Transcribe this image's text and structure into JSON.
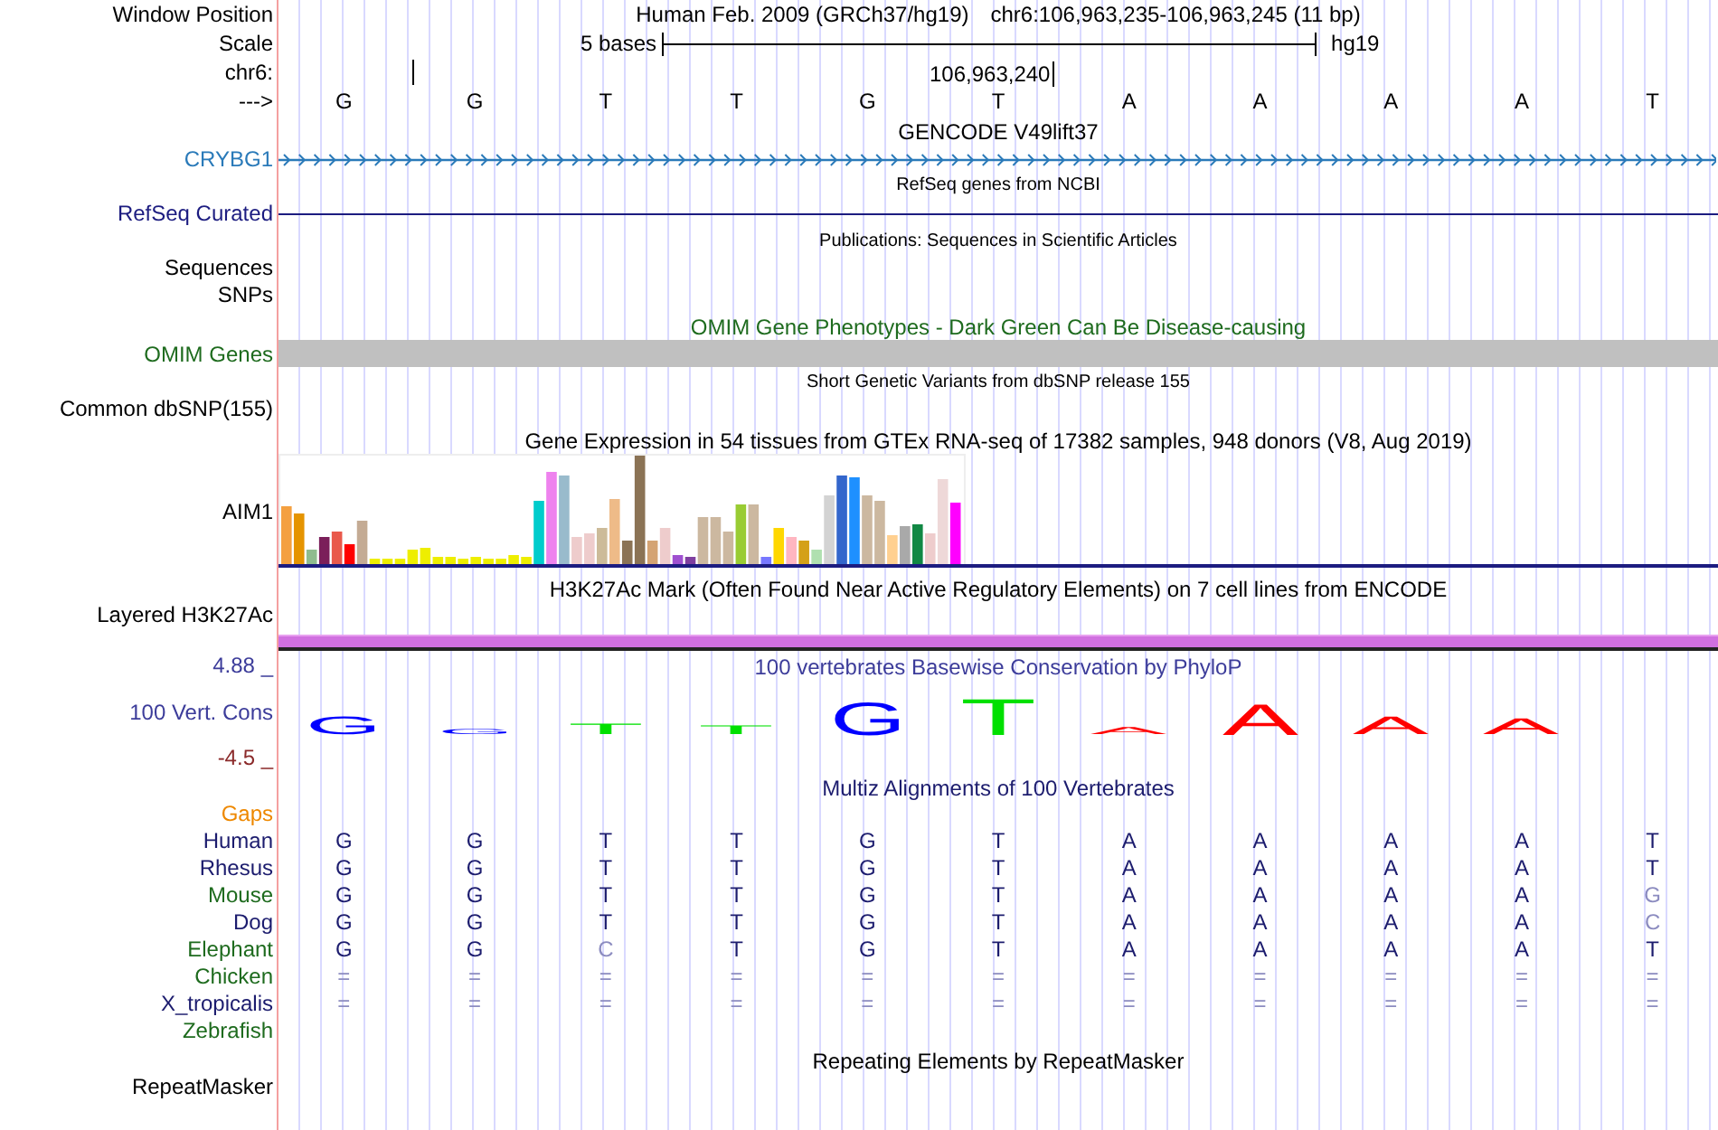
{
  "ruler": {
    "window_label": "Window Position",
    "assembly": "Human Feb. 2009 (GRCh37/hg19)",
    "position": "chr6:106,963,235-106,963,245 (11 bp)",
    "scale_label": "Scale",
    "scale_text": "5 bases",
    "scale_db": "hg19",
    "chrom_label": "chr6:",
    "coordinate": "106,963,240",
    "strand_label": "--->",
    "bases": [
      "G",
      "G",
      "T",
      "T",
      "G",
      "T",
      "A",
      "A",
      "A",
      "A",
      "T"
    ]
  },
  "tracks": [
    {
      "kind": "gene",
      "title": "GENCODE V49lift37",
      "labels": [
        "CRYBG1"
      ],
      "color": "#2a7ab9"
    },
    {
      "kind": "line",
      "title": "RefSeq genes from NCBI",
      "labels": [
        "RefSeq Curated"
      ],
      "color": "#1c1c80"
    },
    {
      "kind": "empty",
      "title": "Publications: Sequences in Scientific Articles",
      "labels": [
        "Sequences",
        "SNPs"
      ],
      "color": "#000000"
    },
    {
      "kind": "bar",
      "title": "OMIM Gene Phenotypes - Dark Green Can Be Disease-causing",
      "labels": [
        "OMIM Genes"
      ],
      "color": "#1e6b1e"
    },
    {
      "kind": "empty",
      "title": "Short Genetic Variants from dbSNP release 155",
      "labels": [
        "Common dbSNP(155)"
      ],
      "color": "#000000"
    },
    {
      "kind": "expression",
      "title": "Gene Expression in 54 tissues from GTEx RNA-seq of 17382 samples, 948 donors (V8, Aug 2019)",
      "labels": [
        "AIM1"
      ],
      "color": "#000000"
    },
    {
      "kind": "layered",
      "title": "H3K27Ac Mark (Often Found Near Active Regulatory Elements) on 7 cell lines from ENCODE",
      "labels": [
        "Layered H3K27Ac"
      ],
      "color": "#000000"
    },
    {
      "kind": "conservation",
      "title": "100 vertebrates Basewise Conservation by PhyloP",
      "labels": [
        "100 Vert. Cons"
      ],
      "color": "#3c3c9a",
      "max_label": "4.88 _",
      "min_label": "-4.5 _",
      "letters": [
        {
          "base": "G",
          "color": "#0000ff"
        },
        {
          "base": "G",
          "color": "#0000ff"
        },
        {
          "base": "T",
          "color": "#00e000"
        },
        {
          "base": "T",
          "color": "#00e000"
        },
        {
          "base": "G",
          "color": "#0000ff"
        },
        {
          "base": "T",
          "color": "#00e000"
        },
        {
          "base": "A",
          "color": "#ff0000"
        },
        {
          "base": "A",
          "color": "#ff0000"
        },
        {
          "base": "A",
          "color": "#ff0000"
        },
        {
          "base": "A",
          "color": "#ff0000"
        }
      ]
    },
    {
      "kind": "alignment",
      "title": "Multiz Alignments of 100 Vertebrates",
      "labels": [
        "Gaps"
      ],
      "color": "#ee8800",
      "species": [
        {
          "name": "Human",
          "color": "#1c1c6e",
          "bases": [
            {
              "text": "G",
              "faint": false
            },
            {
              "text": "G",
              "faint": false
            },
            {
              "text": "T",
              "faint": false
            },
            {
              "text": "T",
              "faint": false
            },
            {
              "text": "G",
              "faint": false
            },
            {
              "text": "T",
              "faint": false
            },
            {
              "text": "A",
              "faint": false
            },
            {
              "text": "A",
              "faint": false
            },
            {
              "text": "A",
              "faint": false
            },
            {
              "text": "A",
              "faint": false
            },
            {
              "text": "T",
              "faint": false
            }
          ]
        },
        {
          "name": "Rhesus",
          "color": "#1c1c6e",
          "bases": [
            {
              "text": "G",
              "faint": false
            },
            {
              "text": "G",
              "faint": false
            },
            {
              "text": "T",
              "faint": false
            },
            {
              "text": "T",
              "faint": false
            },
            {
              "text": "G",
              "faint": false
            },
            {
              "text": "T",
              "faint": false
            },
            {
              "text": "A",
              "faint": false
            },
            {
              "text": "A",
              "faint": false
            },
            {
              "text": "A",
              "faint": false
            },
            {
              "text": "A",
              "faint": false
            },
            {
              "text": "T",
              "faint": false
            }
          ]
        },
        {
          "name": "Mouse",
          "color": "#1e6b1e",
          "bases": [
            {
              "text": "G",
              "faint": false
            },
            {
              "text": "G",
              "faint": false
            },
            {
              "text": "T",
              "faint": false
            },
            {
              "text": "T",
              "faint": false
            },
            {
              "text": "G",
              "faint": false
            },
            {
              "text": "T",
              "faint": false
            },
            {
              "text": "A",
              "faint": false
            },
            {
              "text": "A",
              "faint": false
            },
            {
              "text": "A",
              "faint": false
            },
            {
              "text": "A",
              "faint": false
            },
            {
              "text": "G",
              "faint": true
            }
          ]
        },
        {
          "name": "Dog",
          "color": "#1c1c6e",
          "bases": [
            {
              "text": "G",
              "faint": false
            },
            {
              "text": "G",
              "faint": false
            },
            {
              "text": "T",
              "faint": false
            },
            {
              "text": "T",
              "faint": false
            },
            {
              "text": "G",
              "faint": false
            },
            {
              "text": "T",
              "faint": false
            },
            {
              "text": "A",
              "faint": false
            },
            {
              "text": "A",
              "faint": false
            },
            {
              "text": "A",
              "faint": false
            },
            {
              "text": "A",
              "faint": false
            },
            {
              "text": "C",
              "faint": true
            }
          ]
        },
        {
          "name": "Elephant",
          "color": "#1e6b1e",
          "bases": [
            {
              "text": "G",
              "faint": false
            },
            {
              "text": "G",
              "faint": false
            },
            {
              "text": "C",
              "faint": true
            },
            {
              "text": "T",
              "faint": false
            },
            {
              "text": "G",
              "faint": false
            },
            {
              "text": "T",
              "faint": false
            },
            {
              "text": "A",
              "faint": false
            },
            {
              "text": "A",
              "faint": false
            },
            {
              "text": "A",
              "faint": false
            },
            {
              "text": "A",
              "faint": false
            },
            {
              "text": "T",
              "faint": false
            }
          ]
        },
        {
          "name": "Chicken",
          "color": "#1e6b1e",
          "bases": [
            {
              "text": "=",
              "faint": true
            },
            {
              "text": "=",
              "faint": true
            },
            {
              "text": "=",
              "faint": true
            },
            {
              "text": "=",
              "faint": true
            },
            {
              "text": "=",
              "faint": true
            },
            {
              "text": "=",
              "faint": true
            },
            {
              "text": "=",
              "faint": true
            },
            {
              "text": "=",
              "faint": true
            },
            {
              "text": "=",
              "faint": true
            },
            {
              "text": "=",
              "faint": true
            },
            {
              "text": "=",
              "faint": true
            }
          ]
        },
        {
          "name": "X_tropicalis",
          "color": "#1c1c6e",
          "bases": [
            {
              "text": "=",
              "faint": true
            },
            {
              "text": "=",
              "faint": true
            },
            {
              "text": "=",
              "faint": true
            },
            {
              "text": "=",
              "faint": true
            },
            {
              "text": "=",
              "faint": true
            },
            {
              "text": "=",
              "faint": true
            },
            {
              "text": "=",
              "faint": true
            },
            {
              "text": "=",
              "faint": true
            },
            {
              "text": "=",
              "faint": true
            },
            {
              "text": "=",
              "faint": true
            },
            {
              "text": "=",
              "faint": true
            }
          ]
        },
        {
          "name": "Zebrafish",
          "color": "#1e6b1e"
        }
      ]
    },
    {
      "kind": "repeat",
      "title": "Repeating Elements by RepeatMasker",
      "labels": [
        "RepeatMasker"
      ],
      "color": "#000000"
    }
  ]
}
